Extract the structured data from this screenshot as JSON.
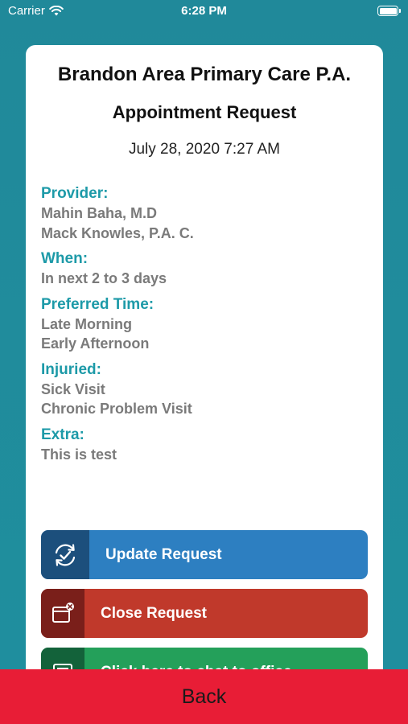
{
  "status_bar": {
    "carrier": "Carrier",
    "time": "6:28 PM"
  },
  "header": {
    "clinic_name": "Brandon Area Primary Care P.A.",
    "title": "Appointment Request",
    "date": "July 28, 2020 7:27 AM"
  },
  "fields": {
    "provider": {
      "label": "Provider:",
      "values": [
        "Mahin Baha, M.D",
        "Mack Knowles, P.A. C."
      ]
    },
    "when": {
      "label": "When:",
      "values": [
        "In next 2 to 3 days"
      ]
    },
    "preferred_time": {
      "label": "Preferred Time:",
      "values": [
        "Late Morning",
        "Early Afternoon"
      ]
    },
    "injuried": {
      "label": "Injuried:",
      "values": [
        "Sick Visit",
        "Chronic Problem Visit"
      ]
    },
    "extra": {
      "label": "Extra:",
      "values": [
        "This is test"
      ]
    }
  },
  "actions": {
    "update": {
      "label": "Update Request",
      "icon": "refresh-check-icon",
      "color": "#2d7fc1"
    },
    "close": {
      "label": "Close Request",
      "icon": "close-window-icon",
      "color": "#c0392b"
    },
    "chat": {
      "label": "Click here to chat to office",
      "icon": "chat-icon",
      "color": "#24a05a"
    }
  },
  "footer": {
    "back_label": "Back",
    "color": "#e81d36"
  },
  "colors": {
    "background": "#20899a",
    "label_accent": "#1d9aa8",
    "value_text": "#7a7a7a"
  }
}
